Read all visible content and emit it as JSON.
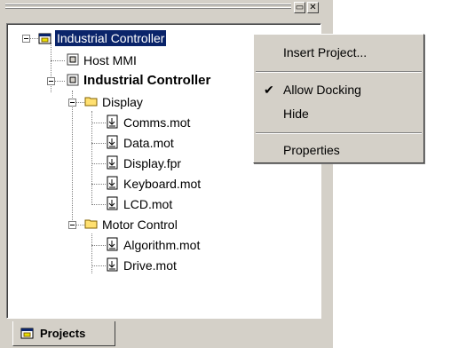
{
  "panel": {
    "window_buttons": {
      "restore": "▭",
      "close": "✕"
    },
    "tree": {
      "root": {
        "label": "Industrial Controller",
        "icon": "project-icon"
      },
      "items": [
        {
          "label": "Host MMI",
          "icon": "project-icon",
          "bold": false
        },
        {
          "label": "Industrial Controller",
          "icon": "project-icon",
          "bold": true
        },
        {
          "label": "Display",
          "icon": "folder-icon"
        },
        {
          "label": "Comms.mot",
          "icon": "file-icon"
        },
        {
          "label": "Data.mot",
          "icon": "file-icon"
        },
        {
          "label": "Display.fpr",
          "icon": "file-icon"
        },
        {
          "label": "Keyboard.mot",
          "icon": "file-icon"
        },
        {
          "label": "LCD.mot",
          "icon": "file-icon"
        },
        {
          "label": "Motor Control",
          "icon": "folder-icon"
        },
        {
          "label": "Algorithm.mot",
          "icon": "file-icon"
        },
        {
          "label": "Drive.mot",
          "icon": "file-icon"
        }
      ]
    },
    "tab": {
      "label": "Projects"
    }
  },
  "context_menu": {
    "items": [
      {
        "label": "Insert Project..."
      },
      {
        "label": "Allow Docking",
        "checked": true
      },
      {
        "label": "Hide"
      },
      {
        "label": "Properties"
      }
    ],
    "check_glyph": "✔"
  }
}
